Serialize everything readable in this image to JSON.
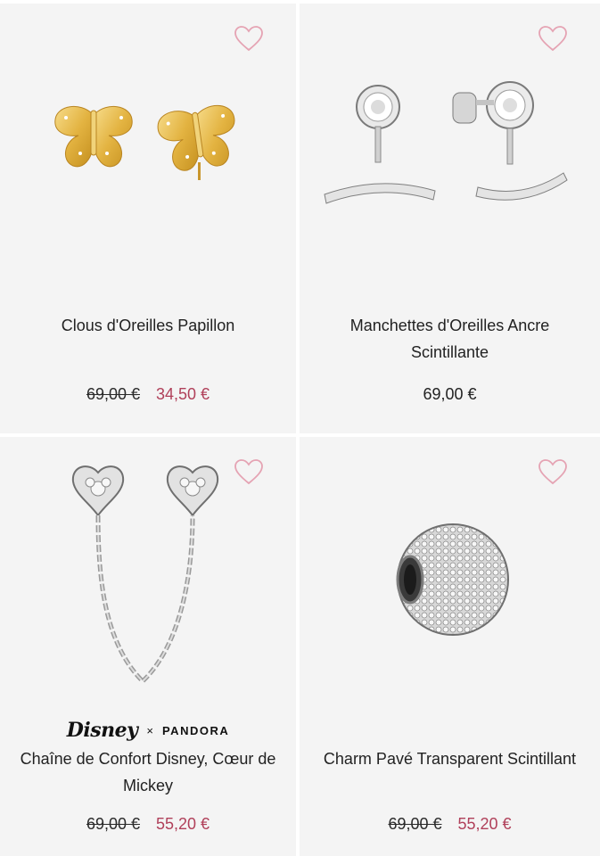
{
  "products": [
    {
      "title": "Clous d'Oreilles Papillon",
      "old_price": "69,00 €",
      "price": "34,50 €",
      "image_icon": "butterfly-earrings-icon",
      "wishlist_icon": "heart-icon"
    },
    {
      "title": "Manchettes d'Oreilles Ancre Scintillante",
      "price": "69,00 €",
      "image_icon": "ear-cuff-earrings-icon",
      "wishlist_icon": "heart-icon"
    },
    {
      "brand_left": "Disney",
      "brand_x": "×",
      "brand_right": "PANDORA",
      "title": "Chaîne de Confort Disney, Cœur de Mickey",
      "old_price": "69,00 €",
      "price": "55,20 €",
      "image_icon": "safety-chain-icon",
      "wishlist_icon": "heart-icon"
    },
    {
      "title": "Charm Pavé Transparent Scintillant",
      "old_price": "69,00 €",
      "price": "55,20 €",
      "image_icon": "pave-charm-icon",
      "wishlist_icon": "heart-icon"
    }
  ],
  "colors": {
    "card_bg": "#f4f4f4",
    "sale_price": "#b0405a",
    "heart": "#e5a3b3",
    "gold": "#e3b341",
    "silver": "#c9c9c9"
  }
}
